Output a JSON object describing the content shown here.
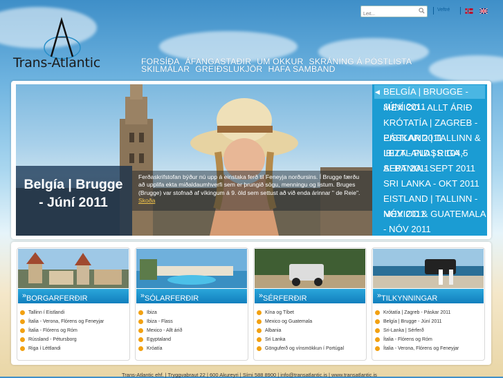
{
  "search": {
    "placeholder": "Leit..."
  },
  "top": {
    "link": "Veftré",
    "flags": [
      "norway-flag-icon",
      "uk-flag-icon"
    ]
  },
  "logo": {
    "text": "Trans-Atlantic"
  },
  "nav": {
    "items": [
      "Forsíða",
      "Áfangastaðir",
      "Um okkur",
      "Skráning á póstlista",
      "Skilmálar",
      "Greiðslukjör",
      "Hafa samband"
    ]
  },
  "hero": {
    "caption": "Belgía | Brugge - Júní 2011",
    "description": "Ferðaskrifstofan býður nú upp á einstaka ferð til Feneyja norðursins. Í Brugge færðu að upplifa ekta miðaldaumhverfi sem er þrungið sögu, menningu og listum. Bruges (Brugge) var stofnað af víkingum á 9. öld sem settust að við enda árinnar \" de Reie\".",
    "more": "Skoða",
    "side_items": [
      "Belgía | Brugge - Júní 2011",
      "Mexico - Allt árið",
      "Krótatía | Zagreb - Páskar 2011",
      "Eistland | Tallinn & Lettland | Riga - Sept 2011",
      "Ibiza - Flass 104,5",
      "Albania - Sept 2011",
      "Sri Lanka - Okt 2011",
      "Eistland | Tallinn - Nóv 2011",
      "Mexico & Guatemala - Nóv 2011"
    ]
  },
  "cards": [
    {
      "title": "Borgarferðir",
      "items": [
        "Tallinn í Eistlandi",
        "Ítalia - Verona, Flórens og Feneyjar",
        "Ítalia - Flórens og Róm",
        "Rússland - Pétursborg",
        "Riga í Léttlandi"
      ]
    },
    {
      "title": "Sólarferðir",
      "items": [
        "Ibiza",
        "Ibiza - Flass",
        "Mexico - Allt árið",
        "Egyptaland",
        "Króatía"
      ]
    },
    {
      "title": "Sérferðir",
      "items": [
        "Kína og Tíbet",
        "Mexico og Guatemala",
        "Albania",
        "Sri Lanka",
        "Gönguferð og vínsmökkun í Portúgal"
      ]
    },
    {
      "title": "Tilkynningar",
      "items": [
        "Krótatía | Zagreb - Páskar 2011",
        "Belgía | Brugge - Júní 2011",
        "Sri-Lanka | Sérferð",
        "Ítalia - Flórens og Róm",
        "Ítalia - Verona, Flórens og Feneyjar"
      ]
    }
  ],
  "footer": {
    "text": "Trans-Atlantic ehf. | Tryggvabraut 22 | 600 Akureyri | Sími 588 8900 | info@transatlantic.is | www.transatlantic.is"
  },
  "colors": {
    "accent": "#1b9cd3",
    "bullet": "#f2a112",
    "caption_bg": "#0c2a4a"
  }
}
